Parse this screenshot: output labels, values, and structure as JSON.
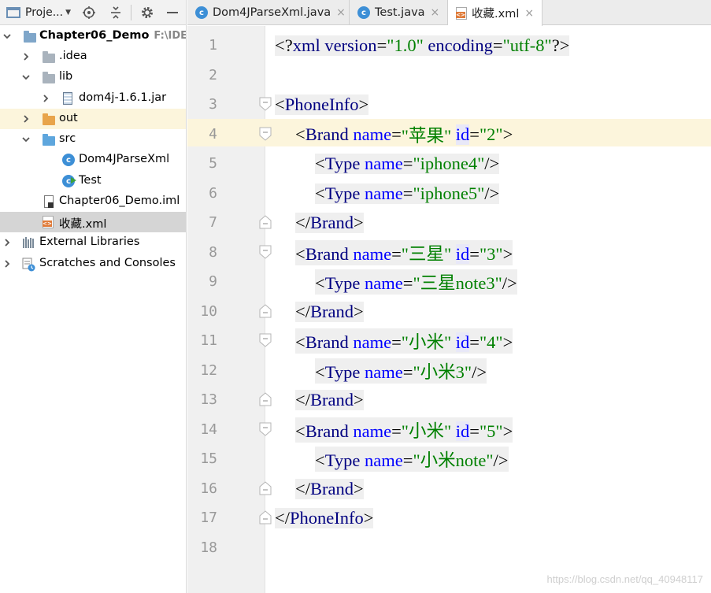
{
  "project_panel": {
    "toolbar": {
      "title": "Proje...",
      "icons": [
        "window-icon",
        "crosshair-icon",
        "collapse-icon",
        "gear-icon",
        "minimize-icon"
      ]
    },
    "tree": [
      {
        "label": "Chapter06_Demo",
        "path": "F:\\IDEA",
        "icon": "folder-icon"
      },
      {
        "label": ".idea",
        "icon": "folder-icon"
      },
      {
        "label": "lib",
        "icon": "folder-icon"
      },
      {
        "label": "dom4j-1.6.1.jar",
        "icon": "jar-icon"
      },
      {
        "label": "out",
        "icon": "folder-icon"
      },
      {
        "label": "src",
        "icon": "folder-icon"
      },
      {
        "label": "Dom4JParseXml",
        "icon": "class-icon"
      },
      {
        "label": "Test",
        "icon": "class-icon"
      },
      {
        "label": "Chapter06_Demo.iml",
        "icon": "iml-icon"
      },
      {
        "label": "收藏.xml",
        "icon": "xml-icon"
      },
      {
        "label": "External Libraries",
        "icon": "libraries-icon"
      },
      {
        "label": "Scratches and Consoles",
        "icon": "scratches-icon"
      }
    ]
  },
  "tabs": [
    {
      "label": "Dom4JParseXml.java",
      "close": "×"
    },
    {
      "label": "Test.java",
      "close": "×"
    },
    {
      "label": "收藏.xml",
      "close": "×"
    }
  ],
  "editor": {
    "line_numbers": [
      "1",
      "2",
      "3",
      "4",
      "5",
      "6",
      "7",
      "8",
      "9",
      "10",
      "11",
      "12",
      "13",
      "14",
      "15",
      "16",
      "17",
      "18"
    ],
    "lines": [
      {
        "t1": "<?",
        "t2": "xml version",
        "t3": "=",
        "t4": "\"1.0\"",
        "t5": " encoding",
        "t6": "=",
        "t7": "\"utf-8\"",
        "t8": "?>"
      },
      {},
      {
        "open": "<",
        "tag": "PhoneInfo",
        "close": ">"
      },
      {
        "open": "<",
        "tag": "Brand",
        "a1": " name",
        "eq1": "=",
        "v1": "\"苹果\"",
        "a2": "id",
        "eq2": "=",
        "v2": "\"2\"",
        "close": ">"
      },
      {
        "open": "<",
        "tag": "Type",
        "a1": " name",
        "eq1": "=",
        "v1": "\"iphone4\"",
        "close": "/>"
      },
      {
        "open": "<",
        "tag": "Type",
        "a1": " name",
        "eq1": "=",
        "v1": "\"iphone5\"",
        "close": "/>"
      },
      {
        "open": "</",
        "tag": "Brand",
        "close": ">"
      },
      {
        "open": "<",
        "tag": "Brand",
        "a1": " name",
        "eq1": "=",
        "v1": "\"三星\"",
        "a2": "id",
        "eq2": "=",
        "v2": "\"3\"",
        "close": ">"
      },
      {
        "open": "<",
        "tag": "Type",
        "a1": " name",
        "eq1": "=",
        "v1": "\"三星note3\"",
        "close": "/>"
      },
      {
        "open": "</",
        "tag": "Brand",
        "close": ">"
      },
      {
        "open": "<",
        "tag": "Brand",
        "a1": " name",
        "eq1": "=",
        "v1": "\"小米\"",
        "a2": "id",
        "eq2": "=",
        "v2": "\"4\"",
        "close": ">"
      },
      {
        "open": "<",
        "tag": "Type",
        "a1": " name",
        "eq1": "=",
        "v1": "\"小米3\"",
        "close": "/>"
      },
      {
        "open": "</",
        "tag": "Brand",
        "close": ">"
      },
      {
        "open": "<",
        "tag": "Brand",
        "a1": " name",
        "eq1": "=",
        "v1": "\"小米\"",
        "a2": "id",
        "eq2": "=",
        "v2": "\"5\"",
        "close": ">"
      },
      {
        "open": "<",
        "tag": "Type",
        "a1": " name",
        "eq1": "=",
        "v1": "\"小米note\"",
        "close": "/>"
      },
      {
        "open": "</",
        "tag": "Brand",
        "close": ">"
      },
      {
        "open": "</",
        "tag": "PhoneInfo",
        "close": ">"
      },
      {}
    ]
  },
  "watermark": "https://blog.csdn.net/qq_40948117",
  "colors": {
    "tag": "#000080",
    "attribute": "#0000ff",
    "value": "#008000",
    "current_line": "#fcf5dc",
    "selection": "#d5d5d5",
    "folder_blue": "#7fa6c9",
    "folder_orange": "#e8a44b"
  }
}
